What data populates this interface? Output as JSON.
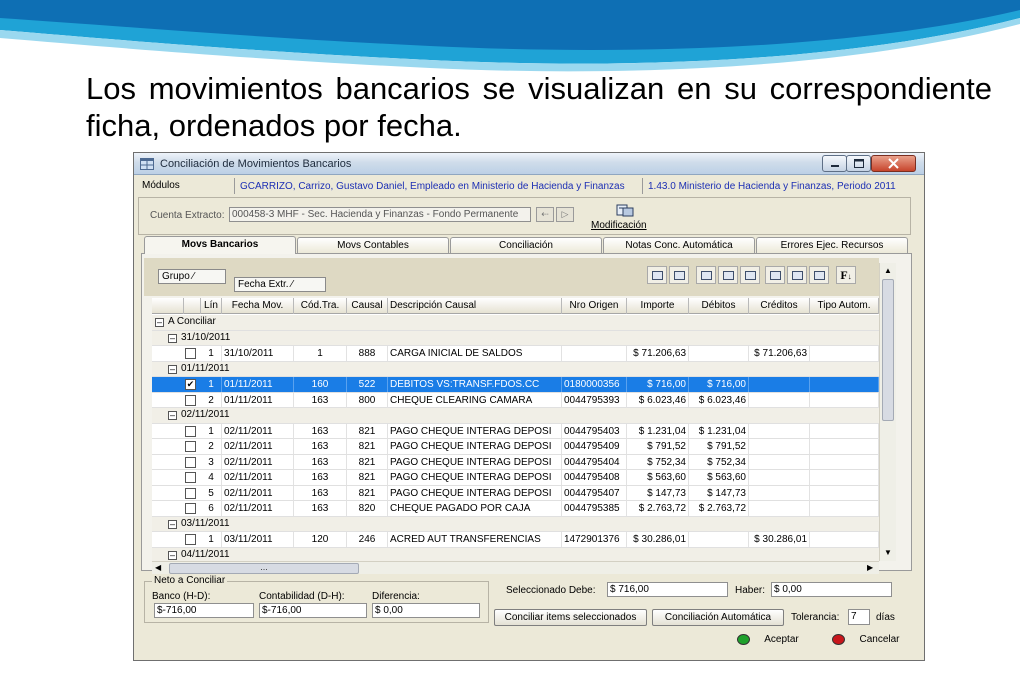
{
  "slide": {
    "text": "Los movimientos bancarios se visualizan en su correspondiente ficha, ordenados por fecha."
  },
  "window": {
    "title": "Conciliación de Movimientos Bancarios",
    "modulos_label": "Módulos",
    "user": "GCARRIZO, Carrizo, Gustavo Daniel, Empleado en Ministerio de Hacienda y Finanzas",
    "version": "1.43.0 Ministerio de Hacienda y Finanzas, Periodo 2011",
    "cuenta_label": "Cuenta Extracto:",
    "cuenta_value": "000458-3 MHF - Sec. Hacienda y Finanzas - Fondo Permanente",
    "modificacion_label": "Modificación"
  },
  "tabs": [
    {
      "label": "Movs Bancarios",
      "active": true
    },
    {
      "label": "Movs Contables",
      "active": false
    },
    {
      "label": "Conciliación",
      "active": false
    },
    {
      "label": "Notas Conc. Automática",
      "active": false
    },
    {
      "label": "Errores Ejec. Recursos",
      "active": false
    }
  ],
  "grouping": {
    "chip1": "Grupo",
    "chip2": "Fecha Extr."
  },
  "grid": {
    "columns": [
      "Lín",
      "Fecha Mov.",
      "Cód.Tra.",
      "Causal",
      "Descripción Causal",
      "Nro Origen",
      "Importe",
      "Débitos",
      "Créditos",
      "Tipo Autom."
    ],
    "rows": [
      {
        "type": "group",
        "level": 0,
        "label": "A Conciliar"
      },
      {
        "type": "group",
        "level": 1,
        "label": "31/10/2011"
      },
      {
        "type": "data",
        "checked": false,
        "selected": false,
        "lin": "1",
        "fecha": "31/10/2011",
        "cod": "1",
        "causal": "888",
        "desc": "CARGA INICIAL DE SALDOS",
        "origen": "",
        "importe": "$ 71.206,63",
        "debitos": "",
        "creditos": "$ 71.206,63",
        "tipo": ""
      },
      {
        "type": "group",
        "level": 1,
        "label": "01/11/2011"
      },
      {
        "type": "data",
        "checked": true,
        "selected": true,
        "lin": "1",
        "fecha": "01/11/2011",
        "cod": "160",
        "causal": "522",
        "desc": "DEBITOS VS:TRANSF.FDOS.CC",
        "origen": "0180000356",
        "importe": "$ 716,00",
        "debitos": "$ 716,00",
        "creditos": "",
        "tipo": ""
      },
      {
        "type": "data",
        "checked": false,
        "selected": false,
        "lin": "2",
        "fecha": "01/11/2011",
        "cod": "163",
        "causal": "800",
        "desc": "CHEQUE CLEARING CAMARA",
        "origen": "0044795393",
        "importe": "$ 6.023,46",
        "debitos": "$ 6.023,46",
        "creditos": "",
        "tipo": ""
      },
      {
        "type": "group",
        "level": 1,
        "label": "02/11/2011"
      },
      {
        "type": "data",
        "checked": false,
        "selected": false,
        "lin": "1",
        "fecha": "02/11/2011",
        "cod": "163",
        "causal": "821",
        "desc": "PAGO CHEQUE INTERAG DEPOSI",
        "origen": "0044795403",
        "importe": "$ 1.231,04",
        "debitos": "$ 1.231,04",
        "creditos": "",
        "tipo": ""
      },
      {
        "type": "data",
        "checked": false,
        "selected": false,
        "lin": "2",
        "fecha": "02/11/2011",
        "cod": "163",
        "causal": "821",
        "desc": "PAGO CHEQUE INTERAG DEPOSI",
        "origen": "0044795409",
        "importe": "$ 791,52",
        "debitos": "$ 791,52",
        "creditos": "",
        "tipo": ""
      },
      {
        "type": "data",
        "checked": false,
        "selected": false,
        "lin": "3",
        "fecha": "02/11/2011",
        "cod": "163",
        "causal": "821",
        "desc": "PAGO CHEQUE INTERAG DEPOSI",
        "origen": "0044795404",
        "importe": "$ 752,34",
        "debitos": "$ 752,34",
        "creditos": "",
        "tipo": ""
      },
      {
        "type": "data",
        "checked": false,
        "selected": false,
        "lin": "4",
        "fecha": "02/11/2011",
        "cod": "163",
        "causal": "821",
        "desc": "PAGO CHEQUE INTERAG DEPOSI",
        "origen": "0044795408",
        "importe": "$ 563,60",
        "debitos": "$ 563,60",
        "creditos": "",
        "tipo": ""
      },
      {
        "type": "data",
        "checked": false,
        "selected": false,
        "lin": "5",
        "fecha": "02/11/2011",
        "cod": "163",
        "causal": "821",
        "desc": "PAGO CHEQUE INTERAG DEPOSI",
        "origen": "0044795407",
        "importe": "$ 147,73",
        "debitos": "$ 147,73",
        "creditos": "",
        "tipo": ""
      },
      {
        "type": "data",
        "checked": false,
        "selected": false,
        "lin": "6",
        "fecha": "02/11/2011",
        "cod": "163",
        "causal": "820",
        "desc": "CHEQUE PAGADO POR CAJA",
        "origen": "0044795385",
        "importe": "$ 2.763,72",
        "debitos": "$ 2.763,72",
        "creditos": "",
        "tipo": ""
      },
      {
        "type": "group",
        "level": 1,
        "label": "03/11/2011"
      },
      {
        "type": "data",
        "checked": false,
        "selected": false,
        "lin": "1",
        "fecha": "03/11/2011",
        "cod": "120",
        "causal": "246",
        "desc": "ACRED AUT TRANSFERENCIAS",
        "origen": "1472901376",
        "importe": "$ 30.286,01",
        "debitos": "",
        "creditos": "$ 30.286,01",
        "tipo": ""
      },
      {
        "type": "group",
        "level": 1,
        "label": "04/11/2011"
      }
    ]
  },
  "totals": {
    "group_label": "Neto a Conciliar",
    "banco_label": "Banco (H-D):",
    "banco_value": "$-716,00",
    "contab_label": "Contabilidad (D-H):",
    "contab_value": "$-716,00",
    "dif_label": "Diferencia:",
    "dif_value": "$ 0,00",
    "sel_debe_label": "Seleccionado Debe:",
    "sel_debe_value": "$ 716,00",
    "haber_label": "Haber:",
    "haber_value": "$ 0,00"
  },
  "actions": {
    "conciliar_sel": "Conciliar items seleccionados",
    "conc_auto": "Conciliación Automática",
    "tolerancia_label": "Tolerancia:",
    "tolerancia_value": "7",
    "dias_label": "días",
    "aceptar": "Aceptar",
    "cancelar": "Cancelar"
  },
  "colors": {
    "selection": "#1a7de6",
    "title_blue": "#1c2fb4",
    "aceptar_dot": "#1fa12c",
    "cancelar_dot": "#c8161b"
  },
  "icons": [
    "app-grid-icon",
    "minimize-icon",
    "maximize-icon",
    "close-icon",
    "modificacion-icon",
    "toolbar-icons",
    "aceptar-icon",
    "cancelar-icon"
  ]
}
